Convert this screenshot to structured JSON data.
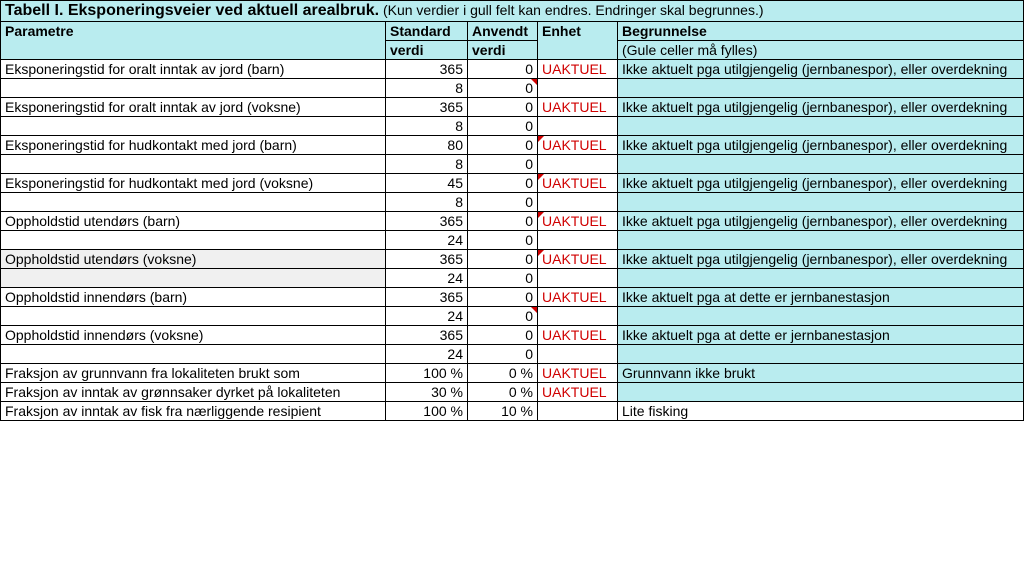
{
  "title_bold": "Tabell I. Eksponeringsveier ved aktuell arealbruk.",
  "title_note": " (Kun verdier i gull felt kan endres. Endringer skal begrunnes.)",
  "headers": {
    "param": "Parametre",
    "std1": "Standard",
    "std2": "verdi",
    "app1": "Anvendt",
    "app2": "verdi",
    "unit": "Enhet",
    "just1": "Begrunnelse",
    "just2": "(Gule celler må fylles)"
  },
  "uaktuel": "UAKTUEL",
  "just_jern": "Ikke aktuelt pga utilgjengelig (jernbanespor), eller overdekning",
  "just_stasjon": "Ikke aktuelt pga at dette er jernbanestasjon",
  "just_grunn": "Grunnvann ikke brukt",
  "just_fisk": "Lite fisking",
  "rows": {
    "r1": {
      "p": "Eksponeringstid for oralt inntak av jord (barn)",
      "s": "365",
      "a": "0"
    },
    "r1b": {
      "s": "8",
      "a": "0"
    },
    "r2": {
      "p": "Eksponeringstid  for oralt inntak av jord (voksne)",
      "s": "365",
      "a": "0"
    },
    "r2b": {
      "s": "8",
      "a": "0"
    },
    "r3": {
      "p": "Eksponeringstid  for hudkontakt med jord (barn)",
      "s": "80",
      "a": "0"
    },
    "r3b": {
      "s": "8",
      "a": "0"
    },
    "r4": {
      "p": "Eksponeringstid for hudkontakt med jord (voksne)",
      "s": "45",
      "a": "0"
    },
    "r4b": {
      "s": "8",
      "a": "0"
    },
    "r5": {
      "p": "Oppholdstid utendørs (barn)",
      "s": "365",
      "a": "0"
    },
    "r5b": {
      "s": "24",
      "a": "0"
    },
    "r6": {
      "p": "Oppholdstid utendørs (voksne)",
      "s": "365",
      "a": "0"
    },
    "r6b": {
      "s": "24",
      "a": "0"
    },
    "r7": {
      "p": "Oppholdstid innendørs (barn)",
      "s": "365",
      "a": "0"
    },
    "r7b": {
      "s": "24",
      "a": "0"
    },
    "r8": {
      "p": "Oppholdstid innendørs (voksne)",
      "s": "365",
      "a": "0"
    },
    "r8b": {
      "s": "24",
      "a": "0"
    },
    "r9": {
      "p": "Fraksjon av grunnvann fra lokaliteten brukt som",
      "s": "100 %",
      "a": "0 %"
    },
    "r10": {
      "p": "Fraksjon av inntak av grønnsaker dyrket på lokaliteten",
      "s": "30 %",
      "a": "0 %"
    },
    "r11": {
      "p": "Fraksjon av inntak av fisk fra nærliggende resipient",
      "s": "100 %",
      "a": "10 %"
    }
  }
}
